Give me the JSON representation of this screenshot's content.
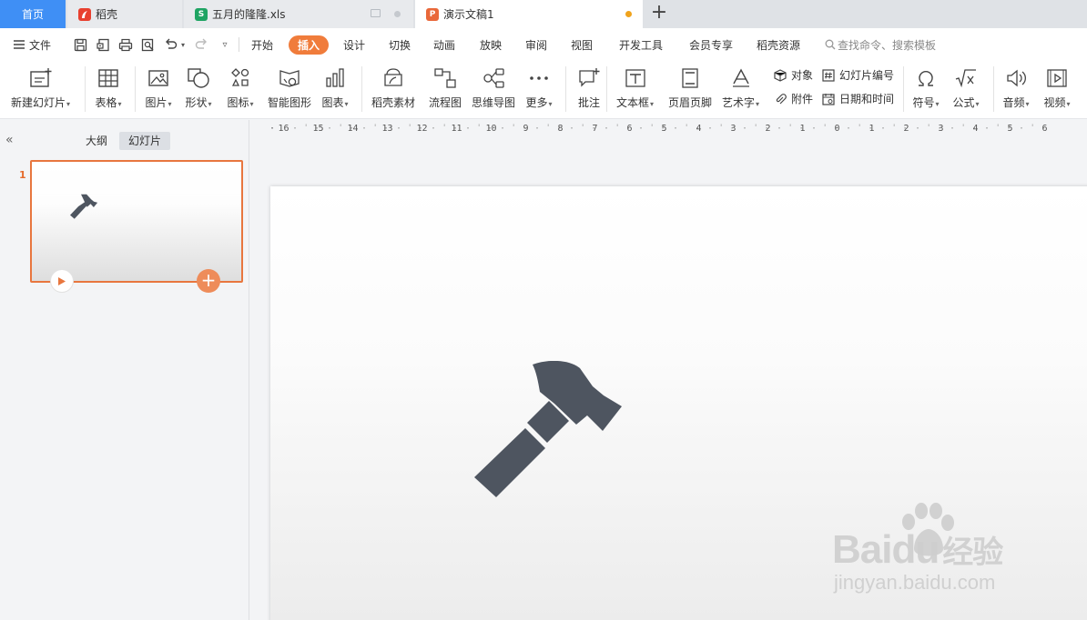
{
  "tabs": [
    {
      "label": "首页"
    },
    {
      "label": "稻壳"
    },
    {
      "label": "五月的隆隆.xls"
    },
    {
      "label": "演示文稿1"
    }
  ],
  "menu": {
    "file_label": "文件",
    "items": [
      "开始",
      "插入",
      "设计",
      "切换",
      "动画",
      "放映",
      "审阅",
      "视图",
      "开发工具",
      "会员专享",
      "稻壳资源"
    ],
    "active_item": "插入",
    "search_placeholder": "查找命令、搜索模板"
  },
  "ribbon": {
    "new_slide": "新建幻灯片",
    "table": "表格",
    "picture": "图片",
    "shape": "形状",
    "icon": "图标",
    "smart_graphic": "智能图形",
    "chart": "图表",
    "daoke_material": "稻壳素材",
    "flowchart": "流程图",
    "mindmap": "思维导图",
    "more": "更多",
    "comment": "批注",
    "textbox": "文本框",
    "header_footer": "页眉页脚",
    "wordart": "艺术字",
    "object": "对象",
    "attachment": "附件",
    "slide_number": "幻灯片编号",
    "date_time": "日期和时间",
    "symbol": "符号",
    "formula": "公式",
    "audio": "音频",
    "video": "视频"
  },
  "left_panel": {
    "outline_tab": "大纲",
    "slides_tab": "幻灯片",
    "slide_number": "1"
  },
  "ruler": {
    "labels": [
      "16",
      "15",
      "14",
      "13",
      "12",
      "11",
      "10",
      "9",
      "8",
      "7",
      "6",
      "5",
      "4",
      "3",
      "2",
      "1",
      "0",
      "1",
      "2",
      "3",
      "4",
      "5",
      "6"
    ]
  },
  "watermark": {
    "brand_latin": "Baidu",
    "brand_cn": "经验",
    "url": "jingyan.baidu.com"
  },
  "colors": {
    "accent_orange": "#f07c3b",
    "home_tab_blue": "#3f8ff5",
    "hammer_gray": "#4e5560"
  }
}
